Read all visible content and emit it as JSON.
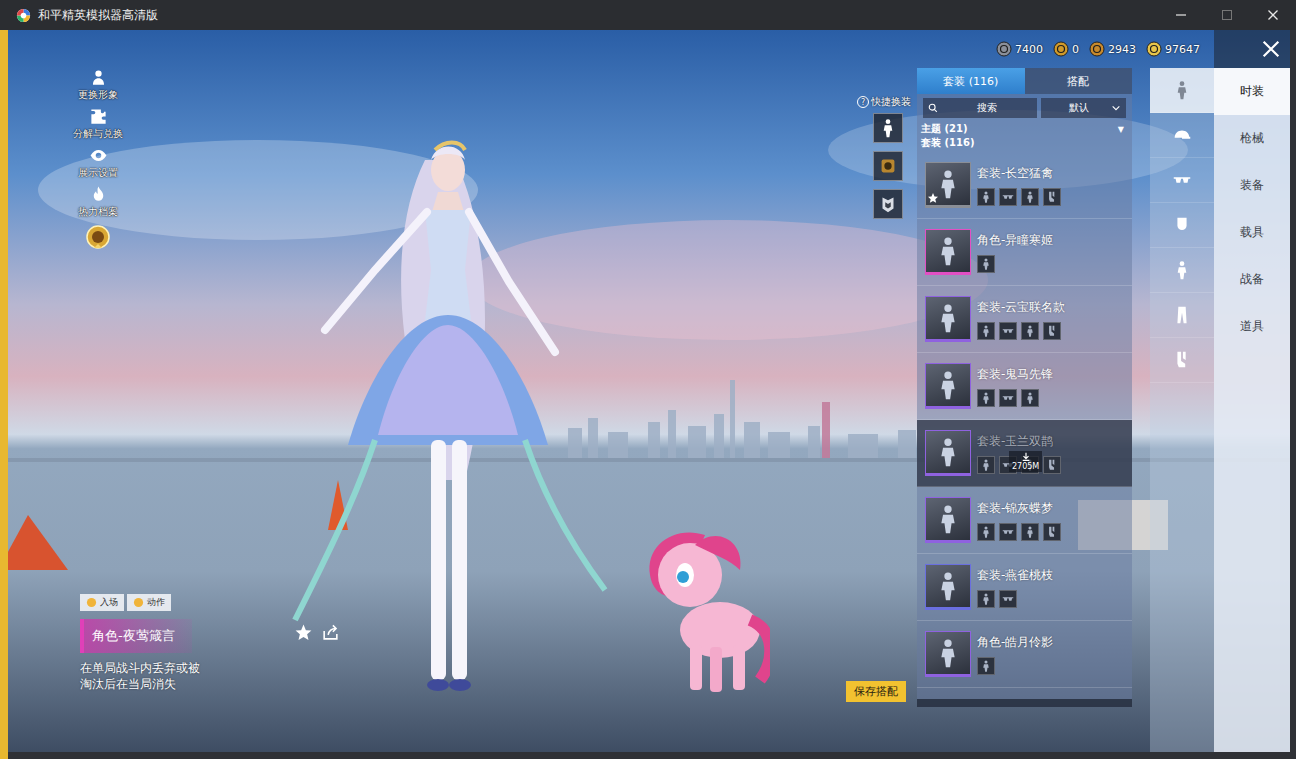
{
  "window": {
    "title": "和平精英模拟器高清版"
  },
  "currencies": [
    {
      "amount": "7400",
      "color": "#8a8f99"
    },
    {
      "amount": "0",
      "color": "#d09a2a"
    },
    {
      "amount": "2943",
      "color": "#c98a2c"
    },
    {
      "amount": "97647",
      "color": "#e8c64a"
    }
  ],
  "side_menu": [
    {
      "label": "更换形象"
    },
    {
      "label": "分解与兑换"
    },
    {
      "label": "展示设置"
    },
    {
      "label": "热力档案"
    }
  ],
  "quick_change": {
    "label": "快捷换装",
    "help": "?"
  },
  "item_info": {
    "tabs": [
      {
        "label": "入场",
        "selected": false
      },
      {
        "label": "动作",
        "selected": false
      }
    ],
    "name": "角色-夜莺箴言",
    "description": "在单局战斗内丢弃或被淘汰后在当局消失"
  },
  "save_button": "保存搭配",
  "panel": {
    "tabs": [
      {
        "label": "套装 (116)",
        "selected": true
      },
      {
        "label": "搭配",
        "selected": false
      }
    ],
    "search": {
      "placeholder": "搜索"
    },
    "sort": {
      "value": "默认"
    },
    "theme": {
      "label": "主题 (21)",
      "arrow": "▼",
      "expanded": false
    },
    "section": "套装 (116)",
    "items": [
      {
        "name": "套装-长空猛禽",
        "parts": 4,
        "color": "#8a8e96",
        "favorite": true,
        "dimmed": false
      },
      {
        "name": "角色-异瞳寒姬",
        "parts": 1,
        "color": "#e24fc4",
        "favorite": false,
        "dimmed": false
      },
      {
        "name": "套装-云宝联名款",
        "parts": 4,
        "color": "#8f62e0",
        "favorite": false,
        "dimmed": false
      },
      {
        "name": "套装-鬼马先锋",
        "parts": 3,
        "color": "#8f62e0",
        "favorite": false,
        "dimmed": false
      },
      {
        "name": "套装-玉兰双鹊",
        "parts": 4,
        "color": "#8f62e0",
        "favorite": false,
        "dimmed": true,
        "download": "2705M"
      },
      {
        "name": "套装-锦灰蝶梦",
        "parts": 4,
        "color": "#8f62e0",
        "favorite": false,
        "dimmed": false
      },
      {
        "name": "套装-燕雀桃枝",
        "parts": 2,
        "color": "#6a6fe0",
        "favorite": false,
        "dimmed": false
      },
      {
        "name": "角色-皓月伶影",
        "parts": 1,
        "color": "#8f62e0",
        "favorite": false,
        "dimmed": false
      }
    ]
  },
  "wardrobe_slots": [
    {
      "selected": true
    },
    {
      "selected": false
    },
    {
      "selected": false
    },
    {
      "selected": false
    },
    {
      "selected": false
    },
    {
      "selected": false
    },
    {
      "selected": false
    }
  ],
  "categories": [
    {
      "label": "时装",
      "selected": true
    },
    {
      "label": "枪械",
      "selected": false
    },
    {
      "label": "装备",
      "selected": false
    },
    {
      "label": "载具",
      "selected": false
    },
    {
      "label": "战备",
      "selected": false
    },
    {
      "label": "道具",
      "selected": false
    }
  ]
}
